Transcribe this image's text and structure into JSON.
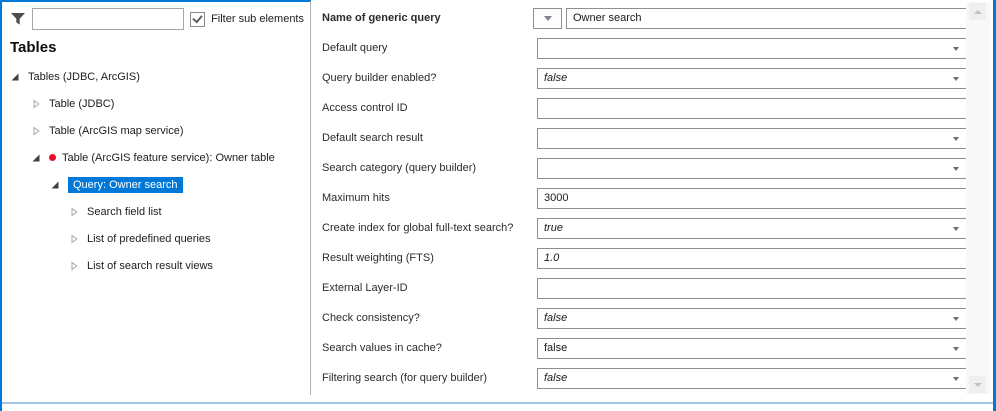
{
  "colors": {
    "accent_blue": "#0078d7",
    "frame_blue": "#0079d8",
    "selection_blue": "#0078d7",
    "marker_red": "#e8112d",
    "bottom_rule_blue": "#a5c7e6",
    "input_border_gray": "#8f8f8f"
  },
  "icons": {
    "filter": "funnel-icon",
    "expanded": "filled-triangle-down-right",
    "collapsed": "outline-triangle-right",
    "dropdown": "small-down-triangle",
    "checkbox": "checkmark",
    "scroll_up": "up-triangle",
    "scroll_down": "down-triangle"
  },
  "filter": {
    "input_value": "",
    "input_placeholder": "",
    "checkbox_label": "Filter sub elements",
    "checkbox_checked": true
  },
  "left_panel": {
    "heading": "Tables",
    "tree": [
      {
        "label": "Tables (JDBC, ArcGIS)",
        "level": 0,
        "expander": "expanded",
        "selected": false,
        "red_dot": false
      },
      {
        "label": "Table (JDBC)",
        "level": 1,
        "expander": "collapsed",
        "selected": false,
        "red_dot": false
      },
      {
        "label": "Table (ArcGIS map service)",
        "level": 1,
        "expander": "collapsed",
        "selected": false,
        "red_dot": false
      },
      {
        "label": "Table (ArcGIS feature service): Owner table",
        "level": 1,
        "expander": "expanded",
        "selected": false,
        "red_dot": true
      },
      {
        "label": "Query: Owner search",
        "level": 2,
        "expander": "expanded",
        "selected": true,
        "red_dot": false
      },
      {
        "label": "Search field list",
        "level": 3,
        "expander": "collapsed",
        "selected": false,
        "red_dot": false
      },
      {
        "label": "List of predefined queries",
        "level": 3,
        "expander": "collapsed",
        "selected": false,
        "red_dot": false
      },
      {
        "label": "List of search result views",
        "level": 3,
        "expander": "collapsed",
        "selected": false,
        "red_dot": false
      }
    ]
  },
  "form": {
    "rows": [
      {
        "label": "Name of generic query",
        "type": "name",
        "value": "Owner search",
        "italic": false
      },
      {
        "label": "Default query",
        "type": "combo",
        "value": "",
        "italic": false
      },
      {
        "label": "Query builder enabled?",
        "type": "combo",
        "value": "false",
        "italic": true
      },
      {
        "label": "Access control ID",
        "type": "text",
        "value": "",
        "italic": false
      },
      {
        "label": "Default search result",
        "type": "combo",
        "value": "",
        "italic": false
      },
      {
        "label": "Search category (query builder)",
        "type": "combo",
        "value": "",
        "italic": false
      },
      {
        "label": "Maximum hits",
        "type": "text",
        "value": "3000",
        "italic": false
      },
      {
        "label": "Create index for global full-text search?",
        "type": "combo",
        "value": "true",
        "italic": true
      },
      {
        "label": "Result weighting (FTS)",
        "type": "text",
        "value": "1.0",
        "italic": true
      },
      {
        "label": "External Layer-ID",
        "type": "text",
        "value": "",
        "italic": false
      },
      {
        "label": "Check consistency?",
        "type": "combo",
        "value": "false",
        "italic": true
      },
      {
        "label": "Search values in cache?",
        "type": "combo",
        "value": "false",
        "italic": false
      },
      {
        "label": "Filtering search (for query builder)",
        "type": "combo",
        "value": "false",
        "italic": true
      }
    ]
  }
}
